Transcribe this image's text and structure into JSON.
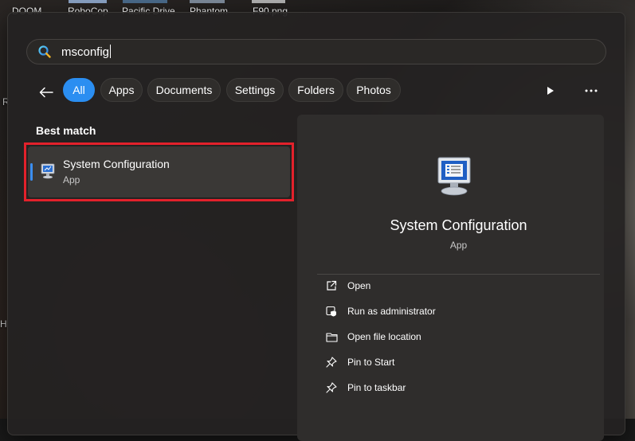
{
  "desktop": {
    "icons": [
      "DOOM",
      "RoboCop",
      "Pacific Drive",
      "Phantom",
      "F90.png"
    ],
    "edge_letters": [
      "R",
      "H"
    ]
  },
  "search": {
    "value": "msconfig"
  },
  "filters": [
    {
      "label": "All",
      "active": true
    },
    {
      "label": "Apps"
    },
    {
      "label": "Documents"
    },
    {
      "label": "Settings"
    },
    {
      "label": "Folders"
    },
    {
      "label": "Photos"
    }
  ],
  "results": {
    "section_label": "Best match",
    "best_match": {
      "title": "System Configuration",
      "subtitle": "App",
      "icon": "system-configuration-icon"
    }
  },
  "details": {
    "title": "System Configuration",
    "subtitle": "App",
    "actions": [
      {
        "label": "Open",
        "icon": "open-external-icon"
      },
      {
        "label": "Run as administrator",
        "icon": "shield-icon"
      },
      {
        "label": "Open file location",
        "icon": "folder-icon"
      },
      {
        "label": "Pin to Start",
        "icon": "pin-icon"
      },
      {
        "label": "Pin to taskbar",
        "icon": "pin-icon"
      }
    ]
  },
  "colors": {
    "accent": "#2b8ef1",
    "highlight": "#e3212b",
    "panel": "#242222"
  }
}
